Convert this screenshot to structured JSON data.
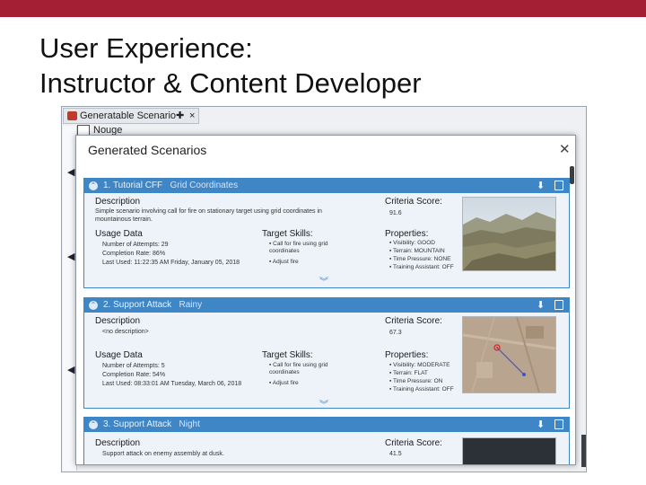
{
  "slide": {
    "title_line1": "User Experience:",
    "title_line2": "Instructor & Content Developer",
    "accent_color": "#a51f34"
  },
  "background_app": {
    "tab_label": "Generatable Scenario",
    "tab_pin": "✚",
    "tab_close": "×",
    "list_label": "Nouge"
  },
  "dialog": {
    "title": "Generated Scenarios",
    "close_icon": "close-icon"
  },
  "scenarios": [
    {
      "header_title": "1. Tutorial CFF",
      "header_subtitle": "Grid Coordinates",
      "description_label": "Description",
      "description": "Simple scenario involving call for fire on stationary target using grid coordinates in mountainous terrain.",
      "criteria_label": "Criteria Score:",
      "criteria_score": "91.6",
      "usage_label": "Usage Data",
      "usage": [
        "Number of Attempts: 29",
        "Completion Rate: 86%",
        "Last Used: 11:22:35 AM Friday, January 05, 2018"
      ],
      "skills_label": "Target Skills:",
      "skills": [
        "Call for fire using grid coordinates",
        "Adjust fire"
      ],
      "properties_label": "Properties:",
      "properties": [
        "Visibility: GOOD",
        "Terrain: MOUNTAIN",
        "Time Pressure: NONE",
        "Training Assistant: OFF"
      ]
    },
    {
      "header_title": "2. Support Attack",
      "header_subtitle": "Rainy",
      "description_label": "Description",
      "description": "<no description>",
      "criteria_label": "Criteria Score:",
      "criteria_score": "67.3",
      "usage_label": "Usage Data",
      "usage": [
        "Number of Attempts: 5",
        "Completion Rate: 54%",
        "Last Used: 08:33:01 AM Tuesday, March 06, 2018"
      ],
      "skills_label": "Target Skills:",
      "skills": [
        "Call for fire using grid coordinates",
        "Adjust fire"
      ],
      "properties_label": "Properties:",
      "properties": [
        "Visibility: MODERATE",
        "Terrain: FLAT",
        "Time Pressure: ON",
        "Training Assistant: OFF"
      ]
    },
    {
      "header_title": "3. Support Attack",
      "header_subtitle": "Night",
      "description_label": "Description",
      "description": "Support attack on enemy assembly at dusk.",
      "criteria_label": "Criteria Score:",
      "criteria_score": "41.5"
    }
  ]
}
